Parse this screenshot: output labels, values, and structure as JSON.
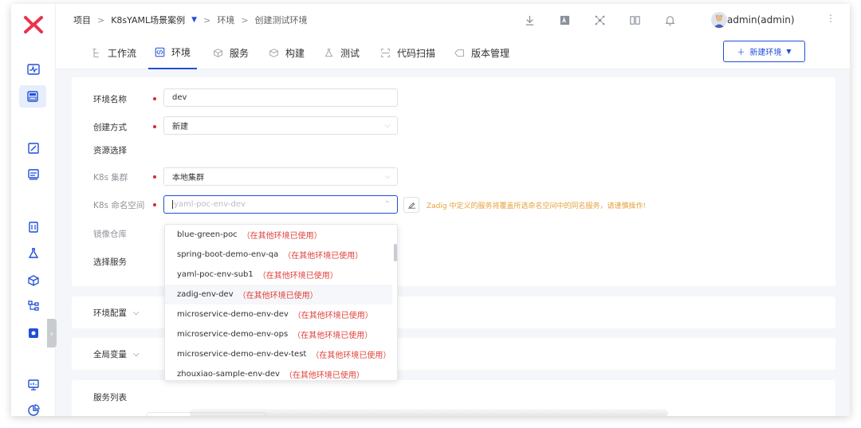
{
  "breadcrumb": {
    "root": "项目",
    "project": "K8sYAML场景案例",
    "env": "环境",
    "current": "创建测试环境"
  },
  "user": {
    "name": "admin(admin)"
  },
  "tabs": [
    {
      "label": "工作流",
      "icon": "workflow-icon"
    },
    {
      "label": "环境",
      "icon": "code-icon",
      "active": true
    },
    {
      "label": "服务",
      "icon": "cube-icon"
    },
    {
      "label": "构建",
      "icon": "box-icon"
    },
    {
      "label": "测试",
      "icon": "flask-icon"
    },
    {
      "label": "代码扫描",
      "icon": "scan-icon"
    },
    {
      "label": "版本管理",
      "icon": "tag-icon"
    }
  ],
  "new_env_button": "新建环境",
  "form": {
    "env_name_label": "环境名称",
    "env_name_value": "dev",
    "create_method_label": "创建方式",
    "create_method_value": "新建",
    "resource_label": "资源选择",
    "cluster_label": "K8s 集群",
    "cluster_value": "本地集群",
    "namespace_label": "K8s 命名空间",
    "namespace_placeholder": "yaml-poc-env-dev",
    "namespace_warning": "Zadig 中定义的服务将覆盖所选命名空间中的同名服务，请谨慎操作!",
    "registry_label": "镜像仓库",
    "service_label": "选择服务"
  },
  "sections": {
    "env_config": "环境配置",
    "global_vars": "全局变量",
    "service_list": "服务列表"
  },
  "namespace_options": [
    {
      "name": "blue-green-poc",
      "note": "（在其他环境已使用）"
    },
    {
      "name": "spring-boot-demo-env-qa",
      "note": "（在其他环境已使用）"
    },
    {
      "name": "yaml-poc-env-sub1",
      "note": "（在其他环境已使用）"
    },
    {
      "name": "zadig-env-dev",
      "note": "（在其他环境已使用）"
    },
    {
      "name": "microservice-demo-env-dev",
      "note": "（在其他环境已使用）"
    },
    {
      "name": "microservice-demo-env-ops",
      "note": "（在其他环境已使用）"
    },
    {
      "name": "microservice-demo-env-dev-test",
      "note": "（在其他环境已使用）"
    },
    {
      "name": "zhouxiao-sample-env-dev",
      "note": "（在其他环境已使用）"
    }
  ],
  "colors": {
    "accent": "#1f4fd8",
    "warning": "#e6a23c",
    "used": "#e0413a",
    "required": "#d9272e"
  }
}
